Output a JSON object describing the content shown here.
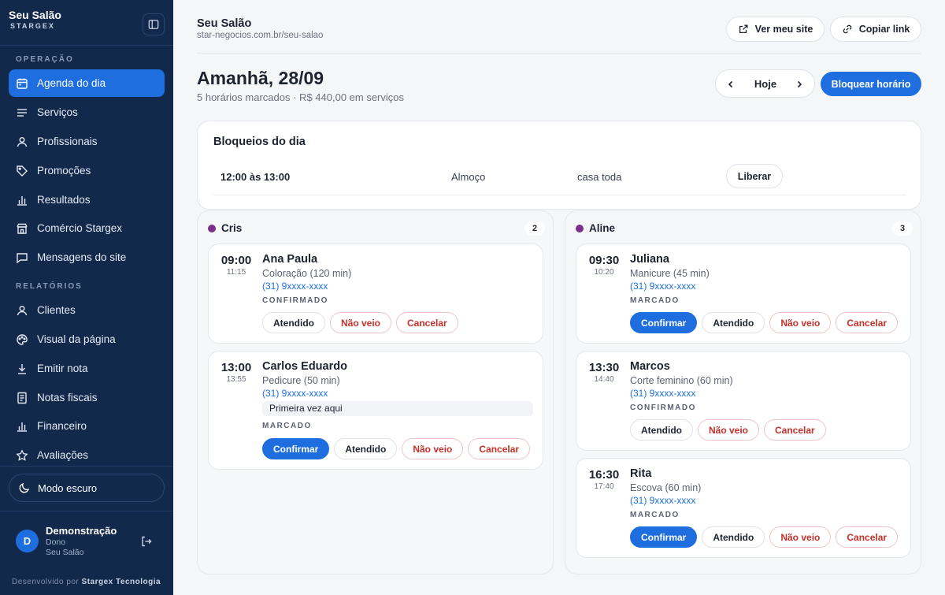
{
  "sidebar": {
    "brand_name": "Seu Salão",
    "brand_sub": "STARGEX",
    "section_operacao": "OPERAÇÃO",
    "section_relatorios": "RELATÓRIOS",
    "items": [
      {
        "label": "Agenda do dia",
        "icon": "calendar-icon",
        "active": true
      },
      {
        "label": "Serviços",
        "icon": "list-icon"
      },
      {
        "label": "Profissionais",
        "icon": "user-icon"
      },
      {
        "label": "Promoções",
        "icon": "tag-icon"
      },
      {
        "label": "Resultados",
        "icon": "bar-chart-icon"
      },
      {
        "label": "Comércio Stargex",
        "icon": "store-icon"
      },
      {
        "label": "Mensagens do site",
        "icon": "message-icon"
      }
    ],
    "report_items": [
      {
        "label": "Clientes",
        "icon": "user-icon"
      },
      {
        "label": "Visual da página",
        "icon": "palette-icon"
      },
      {
        "label": "Emitir nota",
        "icon": "download-icon"
      },
      {
        "label": "Notas fiscais",
        "icon": "receipt-icon"
      },
      {
        "label": "Financeiro",
        "icon": "bar-chart-icon"
      },
      {
        "label": "Avaliações",
        "icon": "star-icon"
      }
    ],
    "dark_mode_label": "Modo escuro",
    "user": {
      "initial": "D",
      "name": "Demonstração",
      "role": "Dono",
      "org": "Seu Salão"
    },
    "footer_prefix": "Desenvolvido por",
    "footer_company": "Stargex Tecnologia"
  },
  "header": {
    "title": "Seu Salão",
    "url": "star-negocios.com.br/seu-salao",
    "view_site_label": "Ver meu site",
    "copy_link_label": "Copiar link"
  },
  "day": {
    "title": "Amanhã, 28/09",
    "summary": "5 horários marcados · R$ 440,00 em serviços",
    "today_label": "Hoje",
    "block_button_label": "Bloquear horário"
  },
  "blocks": {
    "title": "Bloqueios do dia",
    "rows": [
      {
        "time": "12:00 às 13:00",
        "reason": "Almoço",
        "scope": "casa toda",
        "action": "Liberar"
      }
    ]
  },
  "colors": {
    "accent": "#1f6ee0",
    "sidebar": "#13294b",
    "danger": "#c4302b",
    "professional_dot": "#7b2f8a"
  },
  "columns": [
    {
      "name": "Cris",
      "count": "2",
      "appointments": [
        {
          "start": "09:00",
          "end": "11:15",
          "client": "Ana Paula",
          "service": "Coloração (120 min)",
          "phone": "(31) 9xxxx-xxxx",
          "status": "CONFIRMADO",
          "actions": [
            "Atendido",
            "Não veio",
            "Cancelar"
          ]
        },
        {
          "start": "13:00",
          "end": "13:55",
          "client": "Carlos Eduardo",
          "service": "Pedicure (50 min)",
          "phone": "(31) 9xxxx-xxxx",
          "note": "Primeira vez aqui",
          "status": "MARCADO",
          "actions": [
            "Confirmar",
            "Atendido",
            "Não veio",
            "Cancelar"
          ]
        }
      ]
    },
    {
      "name": "Aline",
      "count": "3",
      "appointments": [
        {
          "start": "09:30",
          "end": "10:20",
          "client": "Juliana",
          "service": "Manicure (45 min)",
          "phone": "(31) 9xxxx-xxxx",
          "status": "MARCADO",
          "actions": [
            "Confirmar",
            "Atendido",
            "Não veio",
            "Cancelar"
          ]
        },
        {
          "start": "13:30",
          "end": "14:40",
          "client": "Marcos",
          "service": "Corte feminino (60 min)",
          "phone": "(31) 9xxxx-xxxx",
          "status": "CONFIRMADO",
          "actions": [
            "Atendido",
            "Não veio",
            "Cancelar"
          ]
        },
        {
          "start": "16:30",
          "end": "17:40",
          "client": "Rita",
          "service": "Escova (60 min)",
          "phone": "(31) 9xxxx-xxxx",
          "status": "MARCADO",
          "actions": [
            "Confirmar",
            "Atendido",
            "Não veio",
            "Cancelar"
          ]
        }
      ]
    }
  ]
}
